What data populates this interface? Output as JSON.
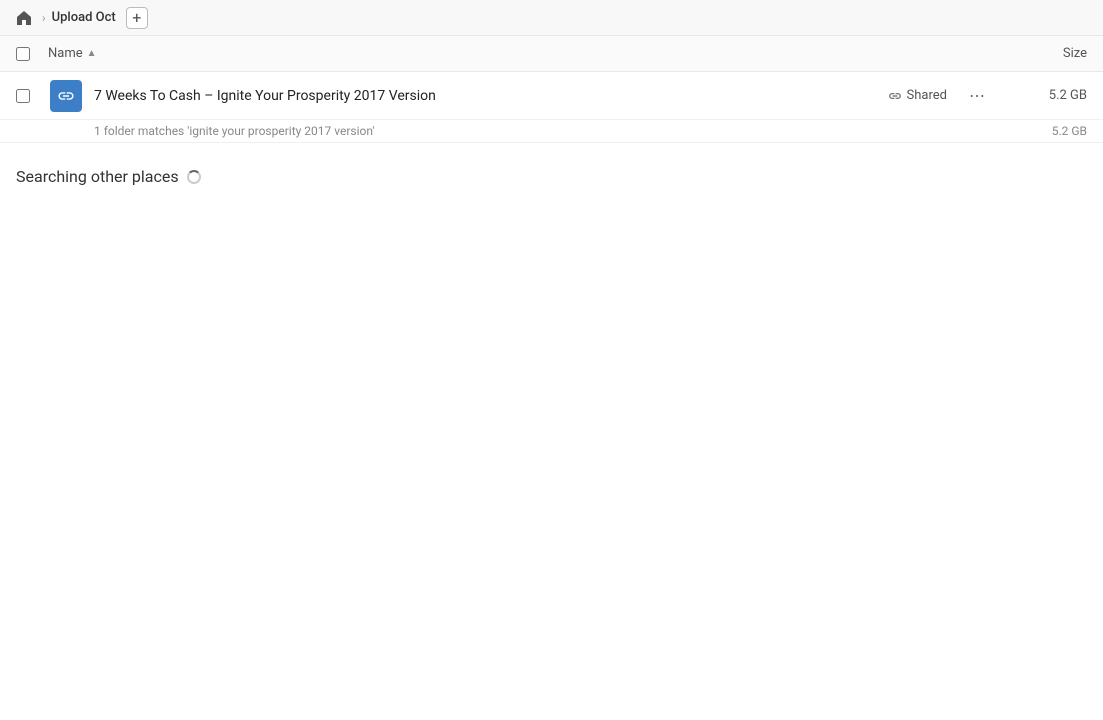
{
  "breadcrumb": {
    "home_label": "Home",
    "folder_name": "Upload Oct",
    "add_button_label": "+"
  },
  "columns": {
    "name_label": "Name",
    "sort_indicator": "▲",
    "size_label": "Size"
  },
  "result": {
    "folder_name": "7 Weeks To Cash – Ignite Your Prosperity 2017 Version",
    "shared_label": "Shared",
    "size": "5.2 GB",
    "match_text": "1 folder matches 'ignite your prosperity 2017 version'",
    "match_size": "5.2 GB"
  },
  "searching": {
    "label": "Searching other places"
  }
}
